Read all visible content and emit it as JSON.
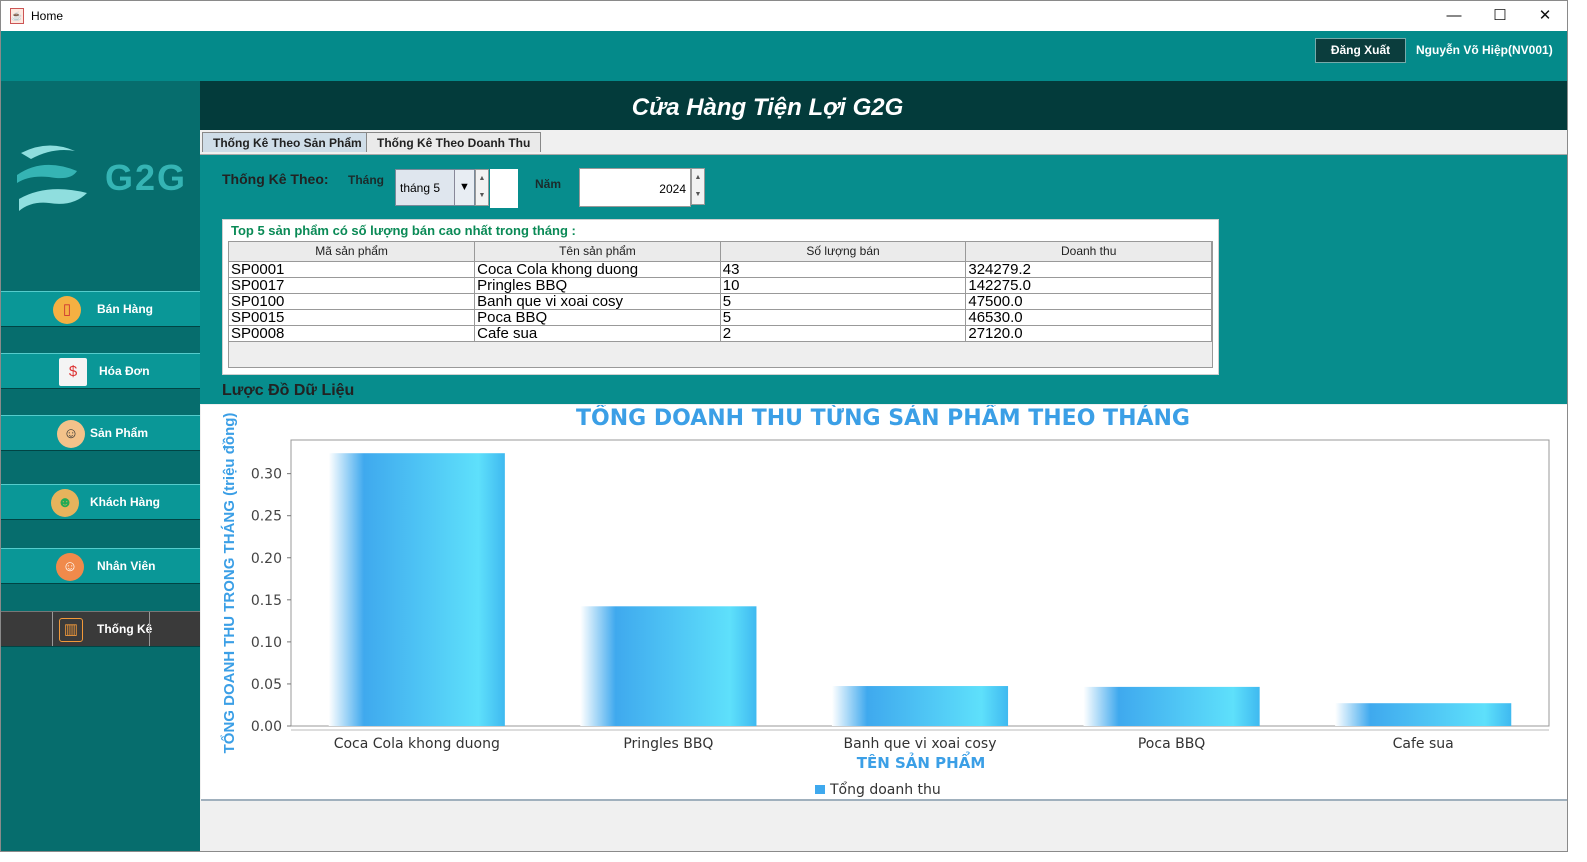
{
  "window": {
    "title": "Home",
    "controls": {
      "minimize": "—",
      "maximize": "☐",
      "close": "✕"
    }
  },
  "header": {
    "logout_label": "Đăng Xuất",
    "user": "Nguyễn Võ Hiệp(NV001)"
  },
  "sidebar": {
    "logo_text": "G2G",
    "items": [
      {
        "label": "Bán Hàng",
        "icon": "phone-cart-icon"
      },
      {
        "label": "Hóa Đơn",
        "icon": "invoice-icon"
      },
      {
        "label": "Sản Phẩm",
        "icon": "product-icon"
      },
      {
        "label": "Khách Hàng",
        "icon": "customers-icon"
      },
      {
        "label": "Nhân Viên",
        "icon": "employee-icon"
      },
      {
        "label": "Thống Kê",
        "icon": "stats-icon",
        "active": true
      }
    ]
  },
  "main": {
    "title": "Cửa Hàng Tiện Lợi G2G",
    "tabs": [
      {
        "label": "Thống Kê Theo Sản Phẩm",
        "selected": true
      },
      {
        "label": "Thống Kê Theo Doanh Thu",
        "selected": false
      }
    ],
    "filter": {
      "label": "Thống Kê Theo:",
      "month_label": "Tháng",
      "month_value": "tháng 5",
      "year_label": "Năm",
      "year_value": "2024"
    },
    "top_table": {
      "title": "Top 5 sản phẩm có số lượng bán cao nhất trong tháng :",
      "columns": [
        "Mã sản phẩm",
        "Tên sản phẩm",
        "Số lượng bán",
        "Doanh thu"
      ],
      "rows": [
        [
          "SP0001",
          "Coca Cola khong duong",
          "43",
          "324279.2"
        ],
        [
          "SP0017",
          "Pringles BBQ",
          "10",
          "142275.0"
        ],
        [
          "SP0100",
          "Banh que vi xoai cosy",
          "5",
          "47500.0"
        ],
        [
          "SP0015",
          "Poca BBQ",
          "5",
          "46530.0"
        ],
        [
          "SP0008",
          "Cafe sua",
          "2",
          "27120.0"
        ]
      ]
    },
    "data_heading": "Lược Đồ Dữ Liệu"
  },
  "chart_data": {
    "type": "bar",
    "title": "TỔNG DOANH THU TỪNG SẢN PHẨM THEO THÁNG",
    "xlabel": "TÊN SẢN PHẨM",
    "ylabel": "TỔNG DOANH THU TRONG THÁNG (triệu đồng)",
    "categories": [
      "Coca Cola khong duong",
      "Pringles BBQ",
      "Banh que vi xoai cosy",
      "Poca BBQ",
      "Cafe sua"
    ],
    "series": [
      {
        "name": "Tổng doanh thu",
        "values": [
          0.3243,
          0.1423,
          0.0475,
          0.0465,
          0.0271
        ]
      }
    ],
    "ylim": [
      0,
      0.34
    ],
    "yticks": [
      "0.00",
      "0.05",
      "0.10",
      "0.15",
      "0.20",
      "0.25",
      "0.30"
    ],
    "legend": "bottom",
    "colors": {
      "bar": "#3fa9ee",
      "title": "#3b9fe6"
    }
  }
}
